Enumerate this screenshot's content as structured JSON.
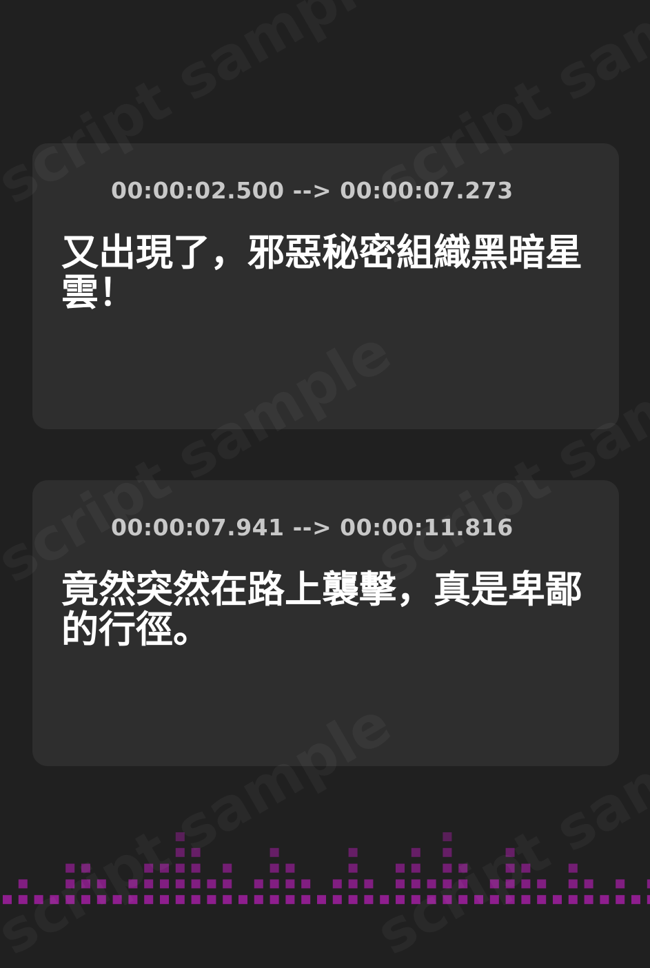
{
  "watermark": "script sample",
  "entries": [
    {
      "timestamp": "00:00:02.500 --> 00:00:07.273",
      "text": "又出現了，邪惡秘密組織黑暗星雲！"
    },
    {
      "timestamp": "00:00:07.941 --> 00:00:11.816",
      "text": "竟然突然在路上襲擊，真是卑鄙的行徑。"
    }
  ],
  "icons": {
    "timestamp": "sound-wave-icon"
  },
  "colors": {
    "background": "#202020",
    "card": "#2e2e2e",
    "accent_pink": "#e040c8",
    "accent_purple": "#8a3cf0",
    "equalizer": "#8e1e8e",
    "text": "#ffffff",
    "timestamp": "#c8c8c8"
  }
}
